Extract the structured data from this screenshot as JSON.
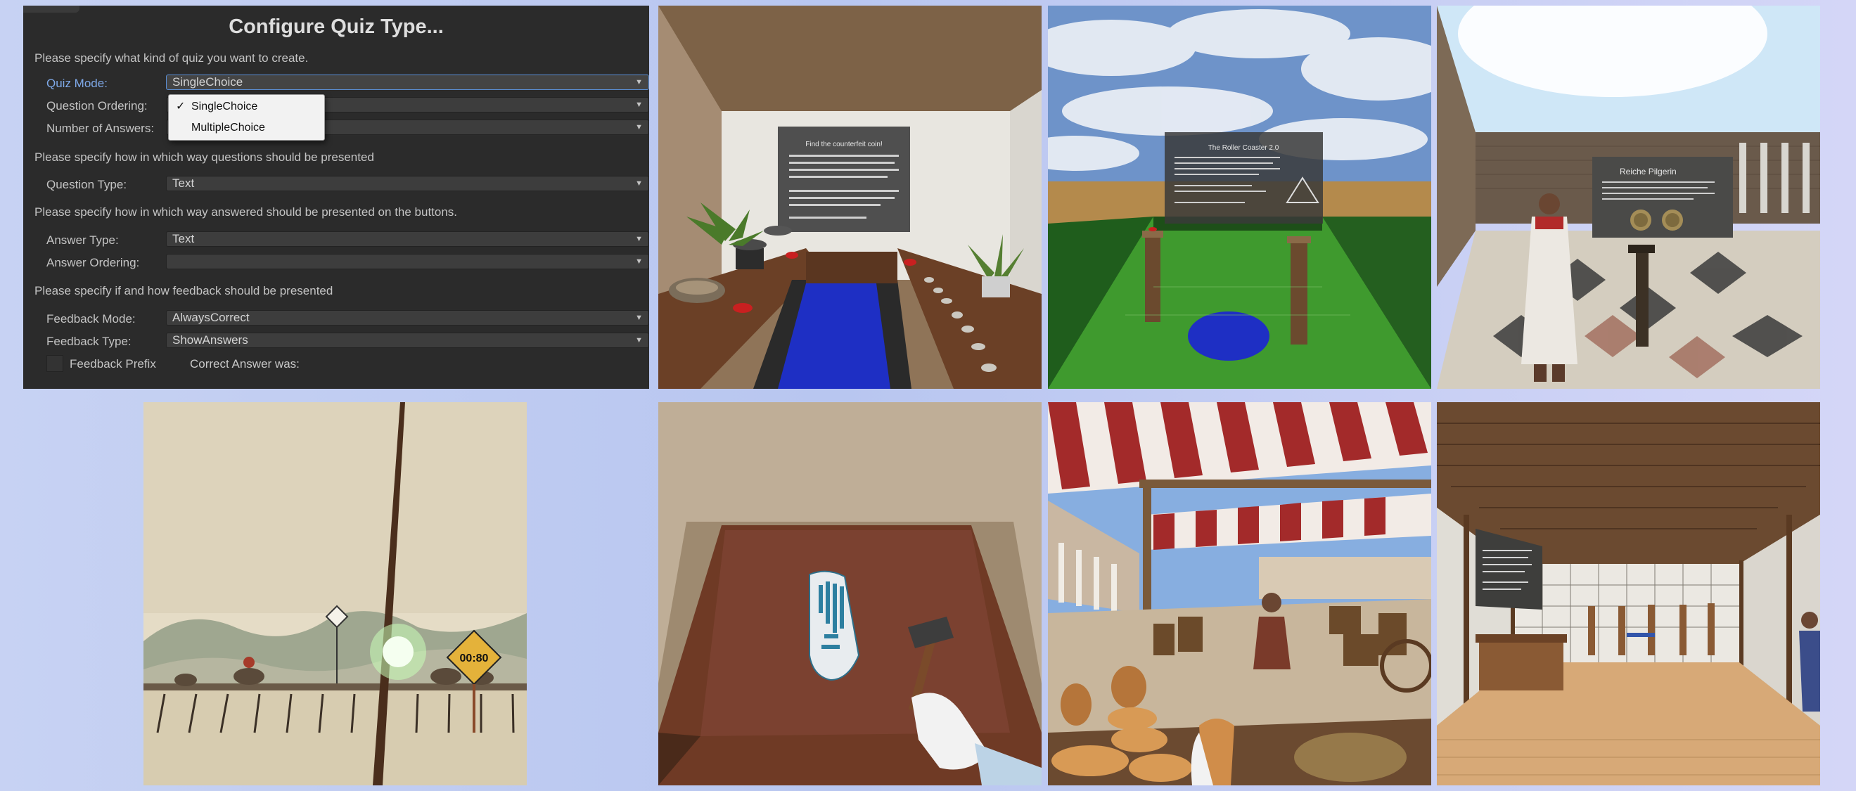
{
  "quiz_config": {
    "title": "Configure Quiz Type...",
    "section_kind": "Please specify what kind of quiz you want to create.",
    "quiz_mode": {
      "label": "Quiz Mode:",
      "value": "SingleChoice"
    },
    "question_ordering": {
      "label": "Question Ordering:",
      "value": ""
    },
    "number_of_answers": {
      "label": "Number of Answers:",
      "value": ""
    },
    "dropdown_options": [
      "SingleChoice",
      "MultipleChoice"
    ],
    "section_questions": "Please specify how in which way questions should be presented",
    "question_type": {
      "label": "Question Type:",
      "value": "Text"
    },
    "section_answers": "Please specify how in which way answered should be presented on the buttons.",
    "answer_type": {
      "label": "Answer Type:",
      "value": "Text"
    },
    "answer_ordering": {
      "label": "Answer Ordering:",
      "value": ""
    },
    "section_feedback": "Please specify if and how feedback should be presented",
    "feedback_mode": {
      "label": "Feedback Mode:",
      "value": "AlwaysCorrect"
    },
    "feedback_type": {
      "label": "Feedback Type:",
      "value": "ShowAnswers"
    },
    "feedback_prefix": {
      "label": "Feedback Prefix",
      "value": "Correct Answer was:"
    }
  },
  "scenes": {
    "museum_room": {
      "board_title": "Find the counterfeit coin!"
    },
    "hedge_field": {
      "board_title": "The Roller Coaster 2.0"
    },
    "courtyard": {
      "board_title": "Reiche Pilgerin"
    },
    "race_game": {
      "timer": "00:80"
    }
  },
  "colors": {
    "panel_bg": "#2b2b2b",
    "field_bg": "#3d3d3d",
    "focus_accent": "#5b8fd6",
    "active_label": "#7fa9e8",
    "page_bg": "#c0cbf1"
  }
}
